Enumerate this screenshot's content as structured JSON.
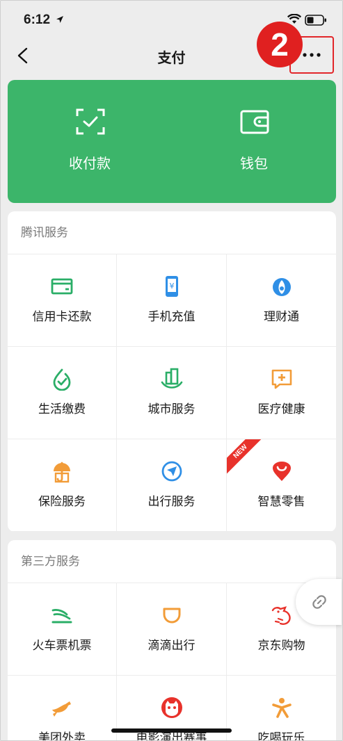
{
  "status_bar": {
    "time": "6:12"
  },
  "nav": {
    "title": "支付",
    "badge_number": "2"
  },
  "pay_card": {
    "items": [
      {
        "label": "收付款",
        "icon": "scan-check-icon"
      },
      {
        "label": "钱包",
        "icon": "wallet-icon"
      }
    ]
  },
  "tencent_services": {
    "title": "腾讯服务",
    "items": [
      {
        "label": "信用卡还款",
        "icon": "credit-card-icon"
      },
      {
        "label": "手机充值",
        "icon": "phone-topup-icon"
      },
      {
        "label": "理财通",
        "icon": "wealth-icon"
      },
      {
        "label": "生活缴费",
        "icon": "utility-bill-icon"
      },
      {
        "label": "城市服务",
        "icon": "city-services-icon"
      },
      {
        "label": "医疗健康",
        "icon": "medical-icon"
      },
      {
        "label": "保险服务",
        "icon": "insurance-icon"
      },
      {
        "label": "出行服务",
        "icon": "travel-icon"
      },
      {
        "label": "智慧零售",
        "icon": "retail-icon",
        "ribbon": "NEW"
      }
    ]
  },
  "third_party_services": {
    "title": "第三方服务",
    "items": [
      {
        "label": "火车票机票",
        "icon": "train-ticket-icon"
      },
      {
        "label": "滴滴出行",
        "icon": "didi-icon"
      },
      {
        "label": "京东购物",
        "icon": "jd-shopping-icon"
      },
      {
        "label": "美团外卖",
        "icon": "meituan-delivery-icon"
      },
      {
        "label": "电影演出赛事",
        "icon": "movie-icon"
      },
      {
        "label": "吃喝玩乐",
        "icon": "entertainment-icon"
      }
    ]
  },
  "colors": {
    "brand_green": "#3cb56a",
    "icon_green": "#2aae67",
    "icon_blue": "#2f8fe6",
    "icon_orange": "#f29c38",
    "icon_red": "#e8322b",
    "highlight_red": "#e02020"
  }
}
